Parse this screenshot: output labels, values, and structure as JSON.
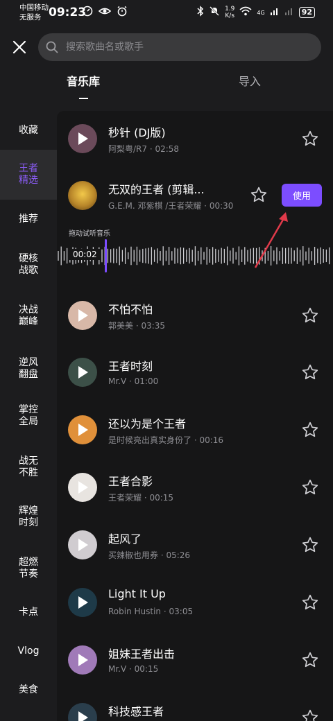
{
  "status_bar": {
    "carrier_line1": "中国移动",
    "carrier_line2": "无服务",
    "time": "09:23",
    "net_speed_value": "1.9",
    "net_speed_unit": "K/s",
    "network_type": "4G",
    "battery": "92"
  },
  "search": {
    "placeholder": "搜索歌曲名或歌手"
  },
  "tabs": [
    {
      "label": "音乐库",
      "active": true
    },
    {
      "label": "导入",
      "active": false
    }
  ],
  "categories": [
    {
      "label": "收藏",
      "active": false
    },
    {
      "label": "王者\n精选",
      "active": true
    },
    {
      "label": "推荐",
      "active": false
    },
    {
      "label": "硬核\n战歌",
      "active": false
    },
    {
      "label": "决战\n巅峰",
      "active": false
    },
    {
      "label": "逆风\n翻盘",
      "active": false
    },
    {
      "label": "掌控\n全局",
      "active": false
    },
    {
      "label": "战无\n不胜",
      "active": false
    },
    {
      "label": "辉煌\n时刻",
      "active": false
    },
    {
      "label": "超燃\n节奏",
      "active": false
    },
    {
      "label": "卡点",
      "active": false
    },
    {
      "label": "Vlog",
      "active": false
    },
    {
      "label": "美食",
      "active": false
    }
  ],
  "selected_track": {
    "use_button": "使用",
    "drag_hint": "拖动试听音乐",
    "position": "00:02"
  },
  "songs": [
    {
      "title": "秒针 (DJ版)",
      "artist": "阿梨粤/R7",
      "duration": "02:58",
      "cover_color": "#6b4a5a",
      "playable": true
    },
    {
      "title": "无双的王者 (剪辑...",
      "artist": "G.E.M. 邓紫棋 /王者荣耀",
      "duration": "00:30",
      "cover_color": "#b8862a",
      "playable": false
    },
    {
      "title": "不怕不怕",
      "artist": "郭美美",
      "duration": "03:35",
      "cover_color": "#d8b8a8",
      "playable": true
    },
    {
      "title": "王者时刻",
      "artist": "Mr.V",
      "duration": "01:00",
      "cover_color": "#3c5048",
      "playable": true
    },
    {
      "title": "还以为是个王者",
      "artist": "是时候亮出真实身份了",
      "duration": "00:16",
      "cover_color": "#e0903a",
      "playable": true
    },
    {
      "title": "王者合影",
      "artist": "王者荣耀",
      "duration": "00:15",
      "cover_color": "#e8e4e0",
      "playable": true
    },
    {
      "title": "起风了",
      "artist": "买辣椒也用券",
      "duration": "05:26",
      "cover_color": "#d0ccd0",
      "playable": true
    },
    {
      "title": "Light It Up",
      "artist": "Robin Hustin",
      "duration": "03:05",
      "cover_color": "#1e3a48",
      "playable": true
    },
    {
      "title": "姐妹王者出击",
      "artist": "Mr.V",
      "duration": "00:15",
      "cover_color": "#a07ab8",
      "playable": true
    },
    {
      "title": "科技感王者",
      "artist": "",
      "duration": "",
      "cover_color": "#2a3e4c",
      "playable": true
    }
  ],
  "colors": {
    "accent": "#7c4dff",
    "active_category": "#8b5cf6",
    "arrow": "#e03a4a"
  }
}
